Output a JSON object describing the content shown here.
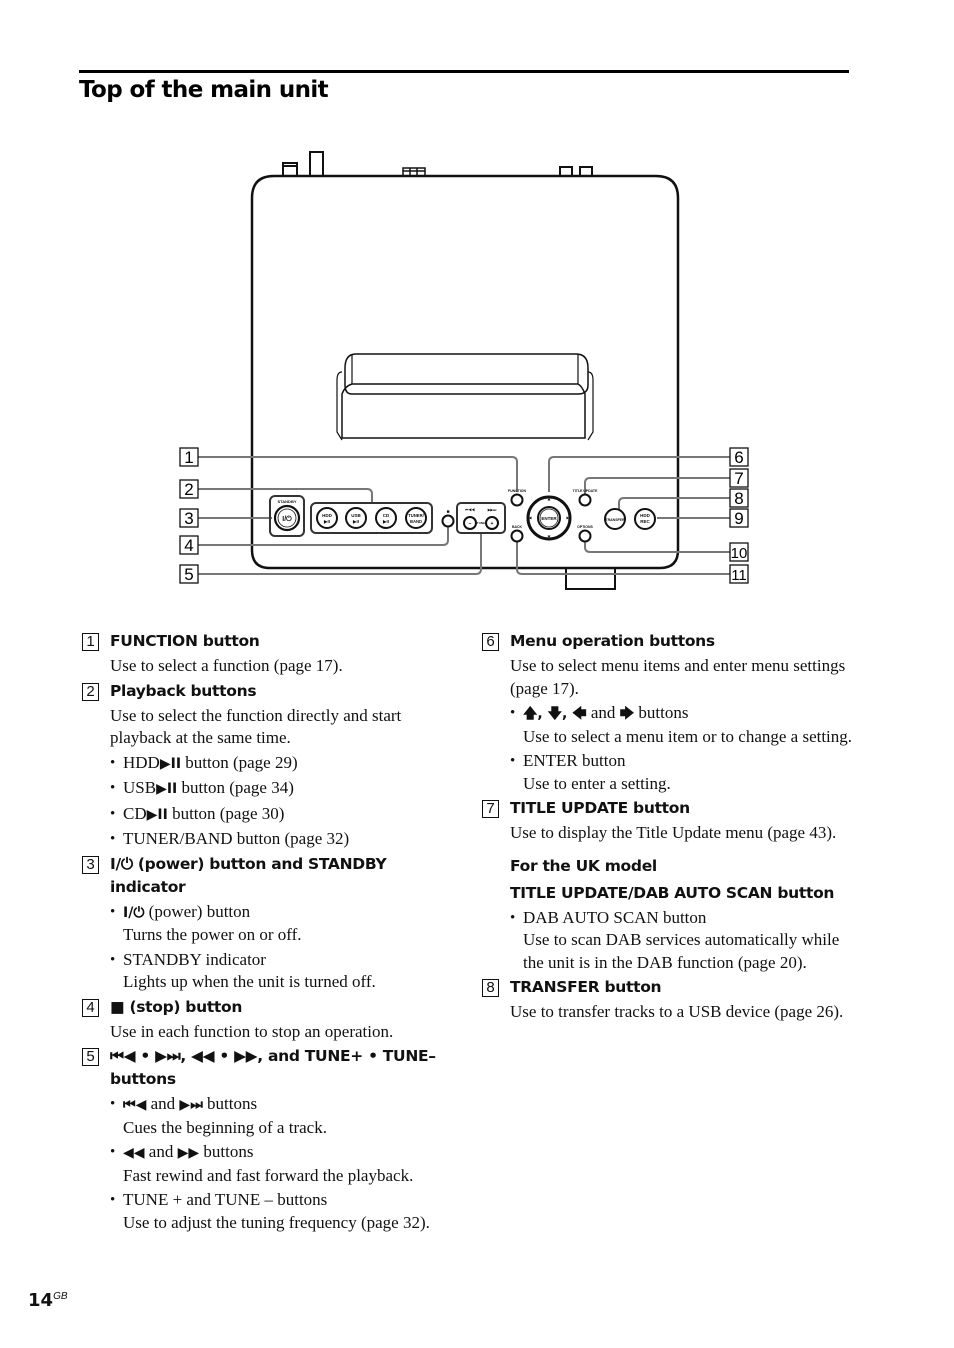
{
  "page": {
    "title": "Top of the main unit",
    "page_number": "14",
    "page_suffix": "GB"
  },
  "diagram": {
    "callouts": [
      "1",
      "2",
      "3",
      "4",
      "5",
      "6",
      "7",
      "8",
      "9",
      "10",
      "11"
    ],
    "button_labels": {
      "standby": "STANDBY",
      "power": "I/⏻",
      "hdd": "HDD",
      "usb": "USB",
      "cd": "CD",
      "play_pause": "▶II",
      "tuner": "TUNER/",
      "band": "BAND",
      "stop": "■",
      "prev": "⏮◀◀",
      "next": "▶▶⏭",
      "tune": "TUNE",
      "minus": "–",
      "plus": "+",
      "function": "FUNCTION",
      "back": "BACK",
      "enter": "ENTER",
      "title_update": "TITLE UPDATE",
      "options": "OPTIONS",
      "transfer": "TRANSFER",
      "hdd_rec_1": "HDD",
      "hdd_rec_2": "REC"
    }
  },
  "items_left": [
    {
      "num": "1",
      "heading": "FUNCTION button",
      "desc": "Use to select a function (page 17)."
    },
    {
      "num": "2",
      "heading": "Playback buttons",
      "desc": "Use to select the function directly and start playback at the same time.",
      "bullets": [
        {
          "pre": "HDD",
          "sym": "▶II",
          "post": " button (page 29)"
        },
        {
          "pre": "USB",
          "sym": "▶II",
          "post": " button (page 34)"
        },
        {
          "pre": "CD",
          "sym": "▶II",
          "post": " button (page 30)"
        },
        {
          "pre": "TUNER/BAND button (page 32)"
        }
      ]
    },
    {
      "num": "3",
      "heading": "I/⏻ (power) button and STANDBY indicator",
      "bullets": [
        {
          "sym": "I/⏻",
          "post": " (power) button",
          "text": "Turns the power on or off."
        },
        {
          "pre": "STANDBY indicator",
          "text": "Lights up when the unit is turned off."
        }
      ]
    },
    {
      "num": "4",
      "heading": "■ (stop) button",
      "desc": "Use in each function to stop an operation."
    },
    {
      "num": "5",
      "heading": "⏮◀ • ▶⏭, ◀◀ • ▶▶, and TUNE+ • TUNE– buttons",
      "bullets": [
        {
          "sym": "⏮◀",
          "mid": " and ",
          "sym2": "▶⏭",
          "post": " buttons",
          "text": "Cues the beginning of a track."
        },
        {
          "sym": "◀◀",
          "mid": " and ",
          "sym2": "▶▶",
          "post": " buttons",
          "text": "Fast rewind and fast forward the playback."
        },
        {
          "pre": "TUNE + and TUNE – buttons",
          "text": "Use to adjust the tuning frequency (page 32)."
        }
      ]
    }
  ],
  "items_right": [
    {
      "num": "6",
      "heading": "Menu operation buttons",
      "desc": "Use to select menu items and enter menu settings (page 17).",
      "bullets": [
        {
          "sym": "🡅, 🡇, 🡄",
          "mid": " and ",
          "sym2": "🡆",
          "post": " buttons",
          "text": "Use to select a menu item or to change a setting."
        },
        {
          "pre": "ENTER button",
          "text": "Use to enter a setting."
        }
      ]
    },
    {
      "num": "7",
      "heading": "TITLE UPDATE button",
      "desc": "Use to display the Title Update menu (page 43).",
      "uk_model": {
        "label": "For the UK model",
        "heading": "TITLE UPDATE/DAB AUTO SCAN button",
        "bullet_title": "DAB AUTO SCAN button",
        "bullet_text": "Use to scan DAB services automatically while the unit is in the DAB function (page 20)."
      }
    },
    {
      "num": "8",
      "heading": "TRANSFER button",
      "desc": "Use to transfer tracks to a USB device (page 26)."
    }
  ]
}
